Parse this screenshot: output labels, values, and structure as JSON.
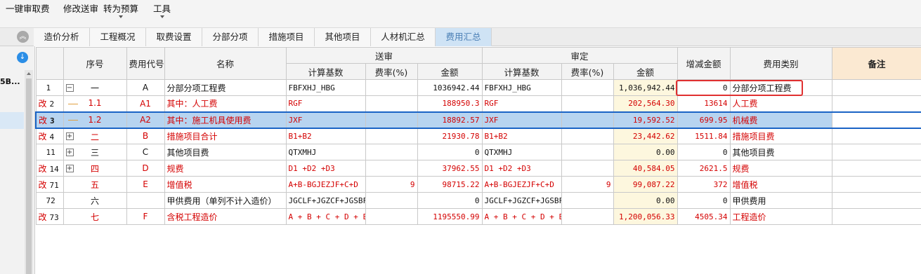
{
  "toolbar": {
    "items": [
      {
        "label": "一键审取费"
      },
      {
        "label": "修改送审"
      },
      {
        "label": "转为预算"
      },
      {
        "label": "工具"
      }
    ]
  },
  "tabs": [
    {
      "label": "造价分析"
    },
    {
      "label": "工程概况"
    },
    {
      "label": "取费设置"
    },
    {
      "label": "分部分项"
    },
    {
      "label": "措施项目"
    },
    {
      "label": "其他项目"
    },
    {
      "label": "人材机汇总"
    },
    {
      "label": "费用汇总",
      "active": true
    }
  ],
  "left_panel": {
    "text": "5B..."
  },
  "table": {
    "headers": {
      "seq": "序号",
      "code": "费用代号",
      "name": "名称",
      "submit_group": "送审",
      "approve_group": "审定",
      "base": "计算基数",
      "rate": "费率(%)",
      "amount": "金额",
      "diff": "增减金额",
      "category": "费用类别",
      "remark": "备注"
    },
    "rows": [
      {
        "mark": "",
        "rownum": "1",
        "tree": "minus",
        "seq": "一",
        "code": "A",
        "name": "分部分项工程费",
        "s_base": "FBFXHJ_HBG",
        "s_rate": "",
        "s_amount": "1036942.44",
        "a_base": "FBFXHJ_HBG",
        "a_rate": "",
        "a_amount": "1,036,942.44",
        "diff": "0",
        "category": "分部分项工程费",
        "red": false
      },
      {
        "mark": "改",
        "rownum": "2",
        "tree": "child",
        "seq": "1.1",
        "code": "A1",
        "name": "其中：人工费",
        "s_base": "RGF",
        "s_rate": "",
        "s_amount": "188950.3",
        "a_base": "RGF",
        "a_rate": "",
        "a_amount": "202,564.30",
        "diff": "13614",
        "category": "人工费",
        "red": true
      },
      {
        "mark": "改",
        "rownum": "3",
        "tree": "child",
        "seq": "1.2",
        "code": "A2",
        "name": "其中：施工机具使用费",
        "s_base": "JXF",
        "s_rate": "",
        "s_amount": "18892.57",
        "a_base": "JXF",
        "a_rate": "",
        "a_amount": "19,592.52",
        "diff": "699.95",
        "category": "机械费",
        "red": true,
        "selected": true
      },
      {
        "mark": "改",
        "rownum": "4",
        "tree": "plus",
        "seq": "二",
        "code": "B",
        "name": "措施项目合计",
        "s_base": "B1+B2",
        "s_rate": "",
        "s_amount": "21930.78",
        "a_base": "B1+B2",
        "a_rate": "",
        "a_amount": "23,442.62",
        "diff": "1511.84",
        "category": "措施项目费",
        "red": true
      },
      {
        "mark": "",
        "rownum": "11",
        "tree": "plus",
        "seq": "三",
        "code": "C",
        "name": "其他项目费",
        "s_base": "QTXMHJ",
        "s_rate": "",
        "s_amount": "0",
        "a_base": "QTXMHJ",
        "a_rate": "",
        "a_amount": "0.00",
        "diff": "0",
        "category": "其他项目费",
        "red": false
      },
      {
        "mark": "改",
        "rownum": "14",
        "tree": "plus",
        "seq": "四",
        "code": "D",
        "name": "规费",
        "s_base": "D1 +D2 +D3",
        "s_rate": "",
        "s_amount": "37962.55",
        "a_base": "D1 +D2 +D3",
        "a_rate": "",
        "a_amount": "40,584.05",
        "diff": "2621.5",
        "category": "规费",
        "red": true
      },
      {
        "mark": "改",
        "rownum": "71",
        "tree": "",
        "seq": "五",
        "code": "E",
        "name": "增值税",
        "s_base": "A+B-BGJEZJF+C+D",
        "s_rate": "9",
        "s_amount": "98715.22",
        "a_base": "A+B-BGJEZJF+C+D",
        "a_rate": "9",
        "a_amount": "99,087.22",
        "diff": "372",
        "category": "增值税",
        "red": true
      },
      {
        "mark": "",
        "rownum": "72",
        "tree": "",
        "seq": "六",
        "code": "",
        "name": "甲供费用（单列不计入造价）",
        "s_base": "JGCLF+JGZCF+JGSBF",
        "s_rate": "",
        "s_amount": "0",
        "a_base": "JGCLF+JGZCF+JGSBF",
        "a_rate": "",
        "a_amount": "0.00",
        "diff": "0",
        "category": "甲供费用",
        "red": false
      },
      {
        "mark": "改",
        "rownum": "73",
        "tree": "",
        "seq": "七",
        "code": "F",
        "name": "含税工程造价",
        "s_base": "A + B + C + D + E",
        "s_rate": "",
        "s_amount": "1195550.99",
        "a_base": "A + B + C + D + E",
        "a_rate": "",
        "a_amount": "1,200,056.33",
        "diff": "4505.34",
        "category": "工程造价",
        "red": true
      }
    ]
  },
  "colors": {
    "accent_red": "#d40000",
    "selection": "#b7d4f0",
    "highlight_column": "#fdf7de",
    "annotation_box": "#e03030"
  }
}
